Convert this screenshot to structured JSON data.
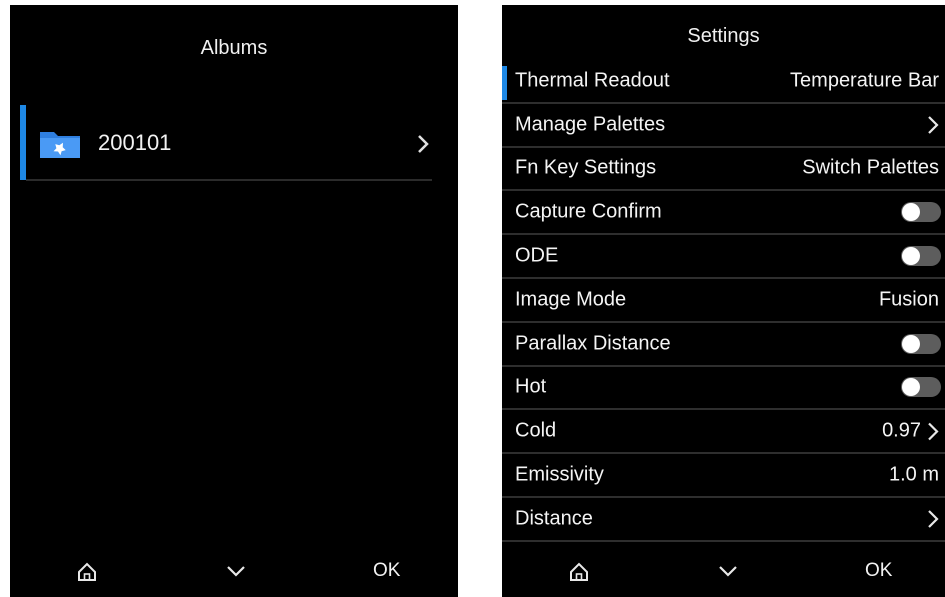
{
  "albums_screen": {
    "title": "Albums",
    "albums": [
      {
        "name": "200101"
      }
    ],
    "bottom_bar": {
      "home_icon": "home-icon",
      "down_icon": "chevron-down-icon",
      "ok_label": "OK"
    }
  },
  "settings_screen": {
    "title": "Settings",
    "items": [
      {
        "label": "Thermal Readout",
        "value": "Temperature Bar",
        "selected": true
      },
      {
        "label": "Manage Palettes",
        "value": "",
        "chevron": true
      },
      {
        "label": "Fn Key Settings",
        "value": "Switch Palettes"
      },
      {
        "label": "Capture Confirm",
        "toggle": "off"
      },
      {
        "label": "ODE",
        "toggle": "off"
      },
      {
        "label": "Image Mode",
        "value": "Fusion"
      },
      {
        "label": "Parallax Distance",
        "toggle": "off"
      },
      {
        "label": "Hot",
        "toggle": "off"
      },
      {
        "label": "Cold",
        "value": "0.97",
        "chevron": true
      },
      {
        "label": "Emissivity",
        "value": "1.0 m"
      },
      {
        "label": "Distance",
        "value": "",
        "chevron": true
      }
    ],
    "bottom_bar": {
      "home_icon": "home-icon",
      "down_icon": "chevron-down-icon",
      "ok_label": "OK"
    }
  },
  "colors": {
    "accent": "#1e88e5",
    "background": "#000000",
    "toggle_off": "#5d5d5d",
    "folder": "#3d8ef0"
  }
}
